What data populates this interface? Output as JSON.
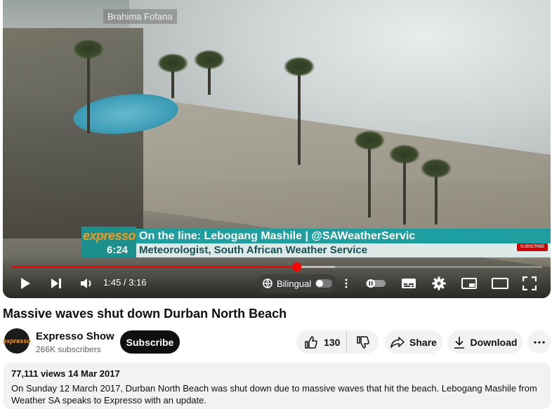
{
  "player": {
    "watermark": "Brahima Fofana",
    "lower_third": {
      "brand": "expresso",
      "time": "6:24",
      "line1": "On the line: Lebogang Mashile | @SAWeatherServic",
      "line2": "Meteorologist, South African Weather Service"
    },
    "yt_subscribe_badge": "SUBSCRIBE",
    "progress": {
      "played_fraction": 0.537,
      "buffered_fraction": 0.61
    },
    "time_display": "1:45 / 3:16",
    "bilingual_label": "Bilingual",
    "icons": [
      "play-icon",
      "next-icon",
      "volume-icon",
      "translate-icon",
      "more-vert-icon",
      "autoplay-icon",
      "subtitles-icon",
      "settings-icon",
      "miniplayer-icon",
      "theater-icon",
      "fullscreen-icon"
    ]
  },
  "video": {
    "title": "Massive waves shut down Durban North Beach"
  },
  "channel": {
    "avatar_text": "expresso",
    "name": "Expresso Show",
    "subscribers": "266K subscribers",
    "subscribe_label": "Subscribe"
  },
  "actions": {
    "likes": "130",
    "share_label": "Share",
    "download_label": "Download"
  },
  "description": {
    "meta": "77,111 views  14 Mar 2017",
    "text": "On Sunday 12 March 2017, Durban North Beach was shut down due to massive waves that hit the beach. Lebogang Mashile from Weather SA speaks to Expresso with an update."
  },
  "colors": {
    "progress": "#ff0000",
    "subscribe_bg": "#0f0f0f",
    "lower_third_teal": "#1f9ea0",
    "brand_orange": "#f39a1e"
  }
}
